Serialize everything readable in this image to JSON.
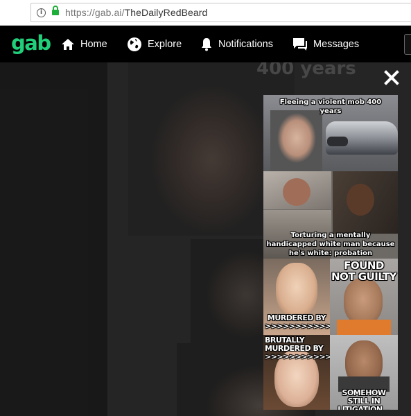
{
  "browser": {
    "url_host": "https://gab.ai/",
    "url_path": "TheDailyRedBeard"
  },
  "nav": {
    "logo": "gab",
    "items": [
      {
        "label": "Home",
        "icon": "home-icon"
      },
      {
        "label": "Explore",
        "icon": "globe-icon"
      },
      {
        "label": "Notifications",
        "icon": "bell-icon"
      },
      {
        "label": "Messages",
        "icon": "chat-icon"
      }
    ]
  },
  "background": {
    "caption": "400 years"
  },
  "lightbox": {
    "close_icon": "close-icon"
  },
  "meme": {
    "panel1_caption": "Fleeing a violent mob 400 years",
    "panel2_caption": "Torturing a mentally handicapped white man because he's white: probation",
    "panel3_caption": "MURDERED BY >>>>>>>>>>>",
    "panel4_caption": "FOUND NOT GUILTY",
    "panel5_caption": "BRUTALLY MURDERED BY >>>>>>>>>>>",
    "panel6_caption": "SOMEHOW STILL IN LITIGATION..."
  },
  "colors": {
    "brand_green": "#21cf7a",
    "nav_bg": "#000000",
    "lock_green": "#1fae3a"
  }
}
